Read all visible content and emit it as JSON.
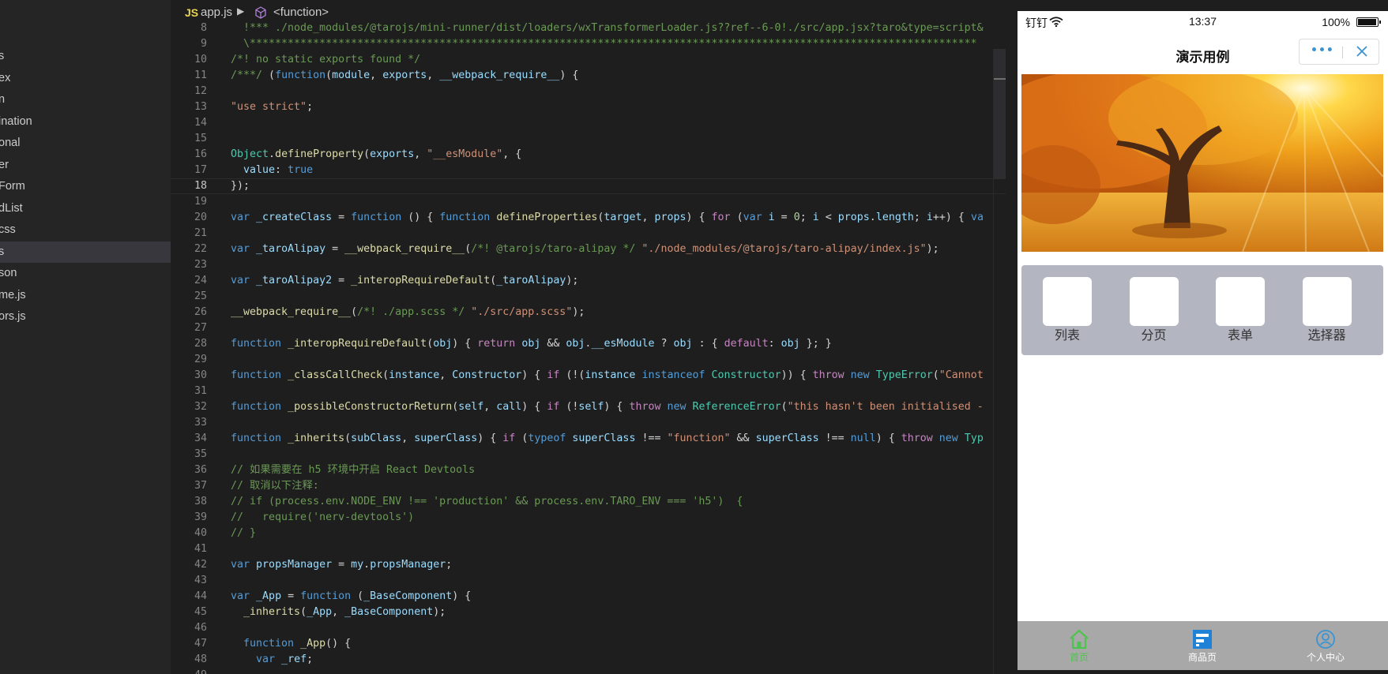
{
  "sidebar": {
    "items": [
      {
        "label": "s",
        "active": false
      },
      {
        "label": "ex",
        "active": false
      },
      {
        "label": "n",
        "active": false
      },
      {
        "label": "ination",
        "active": false
      },
      {
        "label": "onal",
        "active": false
      },
      {
        "label": "er",
        "active": false
      },
      {
        "label": "Form",
        "active": false
      },
      {
        "label": "dList",
        "active": false
      },
      {
        "label": "css",
        "active": false
      },
      {
        "label": "s",
        "active": true
      },
      {
        "label": "son",
        "active": false
      },
      {
        "label": "me.js",
        "active": false
      },
      {
        "label": "ors.js",
        "active": false
      }
    ]
  },
  "breadcrumb": {
    "file_badge": "JS",
    "file": "app.js",
    "separator": "▶",
    "symbol": "<function>"
  },
  "editor": {
    "current_line": 18,
    "lines": [
      {
        "n": 8,
        "tokens": [
          [
            "cm",
            "  !*** ./node_modules/@tarojs/mini-runner/dist/loaders/wxTransformerLoader.js??ref--6-0!./src/app.jsx?taro&type=script&"
          ]
        ]
      },
      {
        "n": 9,
        "tokens": [
          [
            "cm",
            "  \\*******************************************************************************************************************"
          ]
        ]
      },
      {
        "n": 10,
        "tokens": [
          [
            "cm",
            "/*! no static exports found */"
          ]
        ]
      },
      {
        "n": 11,
        "tokens": [
          [
            "cm",
            "/***/ "
          ],
          [
            "",
            "("
          ],
          [
            "kw",
            "function"
          ],
          [
            "",
            "("
          ],
          [
            "var",
            "module"
          ],
          [
            "",
            ", "
          ],
          [
            "var",
            "exports"
          ],
          [
            "",
            ", "
          ],
          [
            "var",
            "__webpack_require__"
          ],
          [
            "",
            ") {"
          ]
        ]
      },
      {
        "n": 12,
        "tokens": []
      },
      {
        "n": 13,
        "tokens": [
          [
            "str",
            "\"use strict\""
          ],
          [
            "",
            ";"
          ]
        ]
      },
      {
        "n": 14,
        "tokens": []
      },
      {
        "n": 15,
        "tokens": []
      },
      {
        "n": 16,
        "tokens": [
          [
            "cls",
            "Object"
          ],
          [
            "",
            "."
          ],
          [
            "fn",
            "defineProperty"
          ],
          [
            "",
            "("
          ],
          [
            "var",
            "exports"
          ],
          [
            "",
            ", "
          ],
          [
            "str",
            "\"__esModule\""
          ],
          [
            "",
            ", {"
          ]
        ]
      },
      {
        "n": 17,
        "tokens": [
          [
            "",
            "  "
          ],
          [
            "var",
            "value"
          ],
          [
            "",
            ": "
          ],
          [
            "kw",
            "true"
          ]
        ]
      },
      {
        "n": 18,
        "tokens": [
          [
            "",
            "});"
          ]
        ]
      },
      {
        "n": 19,
        "tokens": []
      },
      {
        "n": 20,
        "tokens": [
          [
            "kw",
            "var"
          ],
          [
            "",
            " "
          ],
          [
            "var",
            "_createClass"
          ],
          [
            "",
            " = "
          ],
          [
            "kw",
            "function"
          ],
          [
            "",
            " () { "
          ],
          [
            "kw",
            "function"
          ],
          [
            "",
            " "
          ],
          [
            "fn",
            "defineProperties"
          ],
          [
            "",
            "("
          ],
          [
            "var",
            "target"
          ],
          [
            "",
            ", "
          ],
          [
            "var",
            "props"
          ],
          [
            "",
            ") { "
          ],
          [
            "ctl",
            "for"
          ],
          [
            "",
            " ("
          ],
          [
            "kw",
            "var"
          ],
          [
            "",
            " "
          ],
          [
            "var",
            "i"
          ],
          [
            "",
            " = "
          ],
          [
            "num",
            "0"
          ],
          [
            "",
            "; "
          ],
          [
            "var",
            "i"
          ],
          [
            "",
            " < "
          ],
          [
            "var",
            "props"
          ],
          [
            "",
            "."
          ],
          [
            "var",
            "length"
          ],
          [
            "",
            "; "
          ],
          [
            "var",
            "i"
          ],
          [
            "",
            "++) { "
          ],
          [
            "kw",
            "va"
          ]
        ]
      },
      {
        "n": 21,
        "tokens": []
      },
      {
        "n": 22,
        "tokens": [
          [
            "kw",
            "var"
          ],
          [
            "",
            " "
          ],
          [
            "var",
            "_taroAlipay"
          ],
          [
            "",
            " = "
          ],
          [
            "fn",
            "__webpack_require__"
          ],
          [
            "",
            "("
          ],
          [
            "cm",
            "/*! @tarojs/taro-alipay */"
          ],
          [
            "",
            " "
          ],
          [
            "str",
            "\"./node_modules/@tarojs/taro-alipay/index.js\""
          ],
          [
            "",
            ");"
          ]
        ]
      },
      {
        "n": 23,
        "tokens": []
      },
      {
        "n": 24,
        "tokens": [
          [
            "kw",
            "var"
          ],
          [
            "",
            " "
          ],
          [
            "var",
            "_taroAlipay2"
          ],
          [
            "",
            " = "
          ],
          [
            "fn",
            "_interopRequireDefault"
          ],
          [
            "",
            "("
          ],
          [
            "var",
            "_taroAlipay"
          ],
          [
            "",
            ");"
          ]
        ]
      },
      {
        "n": 25,
        "tokens": []
      },
      {
        "n": 26,
        "tokens": [
          [
            "fn",
            "__webpack_require__"
          ],
          [
            "",
            "("
          ],
          [
            "cm",
            "/*! ./app.scss */"
          ],
          [
            "",
            " "
          ],
          [
            "str",
            "\"./src/app.scss\""
          ],
          [
            "",
            ");"
          ]
        ]
      },
      {
        "n": 27,
        "tokens": []
      },
      {
        "n": 28,
        "tokens": [
          [
            "kw",
            "function"
          ],
          [
            "",
            " "
          ],
          [
            "fn",
            "_interopRequireDefault"
          ],
          [
            "",
            "("
          ],
          [
            "var",
            "obj"
          ],
          [
            "",
            ") { "
          ],
          [
            "ctl",
            "return"
          ],
          [
            "",
            " "
          ],
          [
            "var",
            "obj"
          ],
          [
            "",
            " && "
          ],
          [
            "var",
            "obj"
          ],
          [
            "",
            "."
          ],
          [
            "var",
            "__esModule"
          ],
          [
            "",
            " ? "
          ],
          [
            "var",
            "obj"
          ],
          [
            "",
            " : { "
          ],
          [
            "ctl",
            "default"
          ],
          [
            "",
            ": "
          ],
          [
            "var",
            "obj"
          ],
          [
            "",
            " }; }"
          ]
        ]
      },
      {
        "n": 29,
        "tokens": []
      },
      {
        "n": 30,
        "tokens": [
          [
            "kw",
            "function"
          ],
          [
            "",
            " "
          ],
          [
            "fn",
            "_classCallCheck"
          ],
          [
            "",
            "("
          ],
          [
            "var",
            "instance"
          ],
          [
            "",
            ", "
          ],
          [
            "var",
            "Constructor"
          ],
          [
            "",
            ") { "
          ],
          [
            "ctl",
            "if"
          ],
          [
            "",
            " (!("
          ],
          [
            "var",
            "instance"
          ],
          [
            "",
            " "
          ],
          [
            "kw",
            "instanceof"
          ],
          [
            "",
            " "
          ],
          [
            "cls",
            "Constructor"
          ],
          [
            "",
            ")) { "
          ],
          [
            "ctl",
            "throw"
          ],
          [
            "",
            " "
          ],
          [
            "kw",
            "new"
          ],
          [
            "",
            " "
          ],
          [
            "cls",
            "TypeError"
          ],
          [
            "",
            "("
          ],
          [
            "str",
            "\"Cannot"
          ]
        ]
      },
      {
        "n": 31,
        "tokens": []
      },
      {
        "n": 32,
        "tokens": [
          [
            "kw",
            "function"
          ],
          [
            "",
            " "
          ],
          [
            "fn",
            "_possibleConstructorReturn"
          ],
          [
            "",
            "("
          ],
          [
            "var",
            "self"
          ],
          [
            "",
            ", "
          ],
          [
            "var",
            "call"
          ],
          [
            "",
            ") { "
          ],
          [
            "ctl",
            "if"
          ],
          [
            "",
            " (!"
          ],
          [
            "var",
            "self"
          ],
          [
            "",
            ") { "
          ],
          [
            "ctl",
            "throw"
          ],
          [
            "",
            " "
          ],
          [
            "kw",
            "new"
          ],
          [
            "",
            " "
          ],
          [
            "cls",
            "ReferenceError"
          ],
          [
            "",
            "("
          ],
          [
            "str",
            "\"this hasn't been initialised -"
          ]
        ]
      },
      {
        "n": 33,
        "tokens": []
      },
      {
        "n": 34,
        "tokens": [
          [
            "kw",
            "function"
          ],
          [
            "",
            " "
          ],
          [
            "fn",
            "_inherits"
          ],
          [
            "",
            "("
          ],
          [
            "var",
            "subClass"
          ],
          [
            "",
            ", "
          ],
          [
            "var",
            "superClass"
          ],
          [
            "",
            ") { "
          ],
          [
            "ctl",
            "if"
          ],
          [
            "",
            " ("
          ],
          [
            "kw",
            "typeof"
          ],
          [
            "",
            " "
          ],
          [
            "var",
            "superClass"
          ],
          [
            "",
            " !== "
          ],
          [
            "str",
            "\"function\""
          ],
          [
            "",
            " && "
          ],
          [
            "var",
            "superClass"
          ],
          [
            "",
            " !== "
          ],
          [
            "kw",
            "null"
          ],
          [
            "",
            ") { "
          ],
          [
            "ctl",
            "throw"
          ],
          [
            "",
            " "
          ],
          [
            "kw",
            "new"
          ],
          [
            "",
            " "
          ],
          [
            "cls",
            "Typ"
          ]
        ]
      },
      {
        "n": 35,
        "tokens": []
      },
      {
        "n": 36,
        "tokens": [
          [
            "cm",
            "// 如果需要在 h5 环境中开启 React Devtools"
          ]
        ]
      },
      {
        "n": 37,
        "tokens": [
          [
            "cm",
            "// 取消以下注释:"
          ]
        ]
      },
      {
        "n": 38,
        "tokens": [
          [
            "cm",
            "// if (process.env.NODE_ENV !== 'production' && process.env.TARO_ENV === 'h5')  {"
          ]
        ]
      },
      {
        "n": 39,
        "tokens": [
          [
            "cm",
            "//   require('nerv-devtools')"
          ]
        ]
      },
      {
        "n": 40,
        "tokens": [
          [
            "cm",
            "// }"
          ]
        ]
      },
      {
        "n": 41,
        "tokens": []
      },
      {
        "n": 42,
        "tokens": [
          [
            "kw",
            "var"
          ],
          [
            "",
            " "
          ],
          [
            "var",
            "propsManager"
          ],
          [
            "",
            " = "
          ],
          [
            "var",
            "my"
          ],
          [
            "",
            "."
          ],
          [
            "var",
            "propsManager"
          ],
          [
            "",
            ";"
          ]
        ]
      },
      {
        "n": 43,
        "tokens": []
      },
      {
        "n": 44,
        "tokens": [
          [
            "kw",
            "var"
          ],
          [
            "",
            " "
          ],
          [
            "var",
            "_App"
          ],
          [
            "",
            " = "
          ],
          [
            "kw",
            "function"
          ],
          [
            "",
            " ("
          ],
          [
            "var",
            "_BaseComponent"
          ],
          [
            "",
            ") {"
          ]
        ]
      },
      {
        "n": 45,
        "tokens": [
          [
            "",
            "  "
          ],
          [
            "fn",
            "_inherits"
          ],
          [
            "",
            "("
          ],
          [
            "var",
            "_App"
          ],
          [
            "",
            ", "
          ],
          [
            "var",
            "_BaseComponent"
          ],
          [
            "",
            ");"
          ]
        ]
      },
      {
        "n": 46,
        "tokens": []
      },
      {
        "n": 47,
        "tokens": [
          [
            "",
            "  "
          ],
          [
            "kw",
            "function"
          ],
          [
            "",
            " "
          ],
          [
            "fn",
            "_App"
          ],
          [
            "",
            "() {"
          ]
        ]
      },
      {
        "n": 48,
        "tokens": [
          [
            "",
            "    "
          ],
          [
            "kw",
            "var"
          ],
          [
            "",
            " "
          ],
          [
            "var",
            "_ref"
          ],
          [
            "",
            ";"
          ]
        ]
      },
      {
        "n": 49,
        "tokens": []
      }
    ]
  },
  "phone": {
    "status": {
      "carrier": "钉钉",
      "time": "13:37",
      "battery": "100%"
    },
    "navbar": {
      "title": "演示用例",
      "more_glyph": "•••",
      "close_glyph": "✕"
    },
    "banner": {
      "icon": "autumn-tree-photo"
    },
    "grid": [
      {
        "label": "列表"
      },
      {
        "label": "分页"
      },
      {
        "label": "表单"
      },
      {
        "label": "选择器"
      }
    ],
    "tabbar": [
      {
        "label": "首页",
        "icon": "home-icon",
        "active": true
      },
      {
        "label": "商品页",
        "icon": "goods-icon",
        "active": false
      },
      {
        "label": "个人中心",
        "icon": "user-icon",
        "active": false
      }
    ]
  },
  "colors": {
    "editor_bg": "#1e1e1e",
    "sidebar_bg": "#252526",
    "keyword": "#569cd6",
    "string": "#ce9178",
    "comment": "#6a9955",
    "function": "#dcdcaa",
    "variable": "#9cdcfe",
    "class": "#4ec9b0",
    "tab_active": "#4fc34f",
    "grid_panel": "#b3b5c1"
  }
}
